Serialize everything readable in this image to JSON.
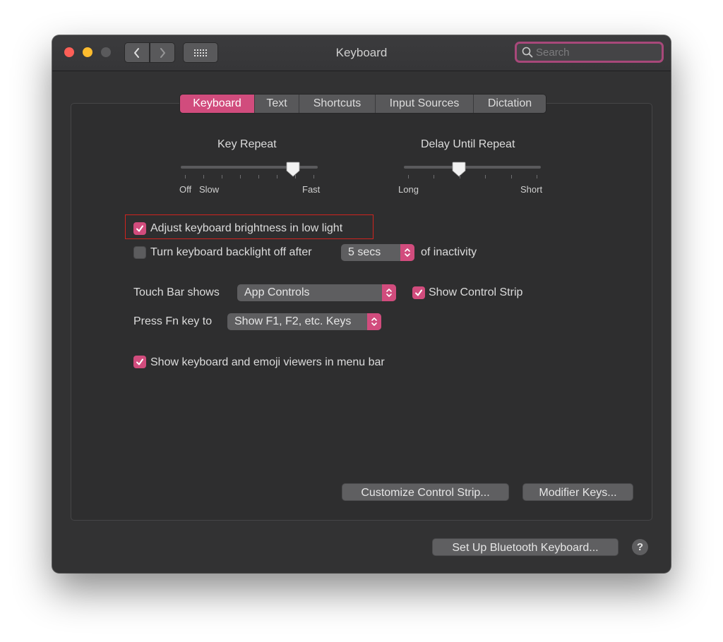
{
  "window": {
    "title": "Keyboard",
    "search": {
      "placeholder": "Search"
    }
  },
  "tabs": [
    {
      "label": "Keyboard",
      "active": true
    },
    {
      "label": "Text",
      "active": false
    },
    {
      "label": "Shortcuts",
      "active": false
    },
    {
      "label": "Input Sources",
      "active": false
    },
    {
      "label": "Dictation",
      "active": false
    }
  ],
  "key_repeat": {
    "title": "Key Repeat",
    "labels": [
      "Off",
      "Slow",
      "Fast"
    ],
    "value_fraction": 0.82
  },
  "delay_until_repeat": {
    "title": "Delay Until Repeat",
    "labels": [
      "Long",
      "Short"
    ],
    "value_fraction": 0.4
  },
  "options": {
    "adjust_brightness": {
      "label": "Adjust keyboard brightness in low light",
      "checked": true
    },
    "backlight_off": {
      "label": "Turn keyboard backlight off after",
      "checked": false,
      "value": "5 secs",
      "suffix": "of inactivity"
    },
    "touch_bar": {
      "label": "Touch Bar shows",
      "value": "App Controls",
      "show_control_strip": {
        "label": "Show Control Strip",
        "checked": true
      }
    },
    "fn_key": {
      "label": "Press Fn key to",
      "value": "Show F1, F2, etc. Keys"
    },
    "show_viewers": {
      "label": "Show keyboard and emoji viewers in menu bar",
      "checked": true
    }
  },
  "buttons": {
    "customize_control_strip": "Customize Control Strip...",
    "modifier_keys": "Modifier Keys...",
    "setup_bluetooth": "Set Up Bluetooth Keyboard...",
    "help": "?"
  },
  "colors": {
    "accent": "#d14c7d",
    "highlight_box": "#d0241f"
  }
}
